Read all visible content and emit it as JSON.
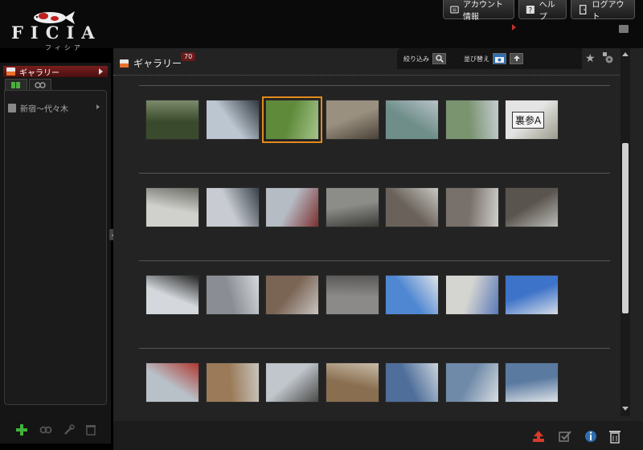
{
  "header": {
    "logo_text": "FICIA",
    "logo_kana": "フィシア",
    "buttons": {
      "account": "アカウント情報",
      "help": "ヘルプ",
      "logout": "ログアウト"
    }
  },
  "sidebar": {
    "nav_gallery": "ギャラリー",
    "tabs": [
      {
        "icon": "book-icon",
        "active": true
      },
      {
        "icon": "link-icon",
        "active": false
      }
    ],
    "tree_item": "新宿〜代々木",
    "footer_icons": [
      "add-icon",
      "link-icon",
      "wrench-icon",
      "trash-icon"
    ]
  },
  "main": {
    "title": "ギャラリー",
    "count": "70",
    "filter_label": "絞り込み",
    "sort_label": "並び替え"
  },
  "thumbs": [
    {
      "label": "",
      "colors": [
        "#3a4a2c",
        "#7a8a6a"
      ]
    },
    {
      "label": "",
      "colors": [
        "#bcc6d0",
        "#303840"
      ]
    },
    {
      "label": "",
      "colors": [
        "#5e8a3a",
        "#a6c48a"
      ]
    },
    {
      "label": "",
      "colors": [
        "#9a9080",
        "#4a4238"
      ]
    },
    {
      "label": "",
      "colors": [
        "#6f8e8a",
        "#b8c2c8"
      ]
    },
    {
      "label": "",
      "colors": [
        "#7a9470",
        "#c4ccd0"
      ]
    },
    {
      "label": "裏参A",
      "colors": [
        "#e4e4e4",
        "#9a9a8a"
      ]
    },
    {
      "label": "",
      "colors": [
        "#d0d0cc",
        "#6c6c66"
      ]
    },
    {
      "label": "",
      "colors": [
        "#c8ccd2",
        "#38404a"
      ]
    },
    {
      "label": "",
      "colors": [
        "#b6bcc4",
        "#7c3030"
      ]
    },
    {
      "label": "",
      "colors": [
        "#8c8c88",
        "#3a3a36"
      ]
    },
    {
      "label": "",
      "colors": [
        "#6a625a",
        "#c8c8c4"
      ]
    },
    {
      "label": "",
      "colors": [
        "#78706a",
        "#d0d0cc"
      ]
    },
    {
      "label": "",
      "colors": [
        "#5a544e",
        "#bcbcb8"
      ]
    },
    {
      "label": "",
      "colors": [
        "#d4d8dc",
        "#222222"
      ]
    },
    {
      "label": "",
      "colors": [
        "#8a8e94",
        "#d4d8dc"
      ]
    },
    {
      "label": "",
      "colors": [
        "#7a6454",
        "#c8c4c0"
      ]
    },
    {
      "label": "",
      "colors": [
        "#8c8a88",
        "#5a5856"
      ]
    },
    {
      "label": "",
      "colors": [
        "#4f87d2",
        "#e0e4e8"
      ]
    },
    {
      "label": "",
      "colors": [
        "#d4d4d0",
        "#5a7ab8"
      ]
    },
    {
      "label": "",
      "colors": [
        "#3d73c8",
        "#d4dce8"
      ]
    },
    {
      "label": "",
      "colors": [
        "#b8c0c8",
        "#b03830"
      ]
    },
    {
      "label": "",
      "colors": [
        "#9a7a58",
        "#c8c4bc"
      ]
    },
    {
      "label": "",
      "colors": [
        "#c0c6cc",
        "#4a4a48"
      ]
    },
    {
      "label": "",
      "colors": [
        "#8a6e50",
        "#c8bca8"
      ]
    },
    {
      "label": "",
      "colors": [
        "#4f6f9a",
        "#cbd4de"
      ]
    },
    {
      "label": "",
      "colors": [
        "#6f8aa8",
        "#d8dde2"
      ]
    },
    {
      "label": "",
      "colors": [
        "#5a7aa0",
        "#dde2e8"
      ]
    }
  ],
  "selected_index": 2,
  "colors": {
    "accent": "#e38a1c",
    "badge": "#6a1a1a",
    "nav_active": "#7a1e1e"
  }
}
